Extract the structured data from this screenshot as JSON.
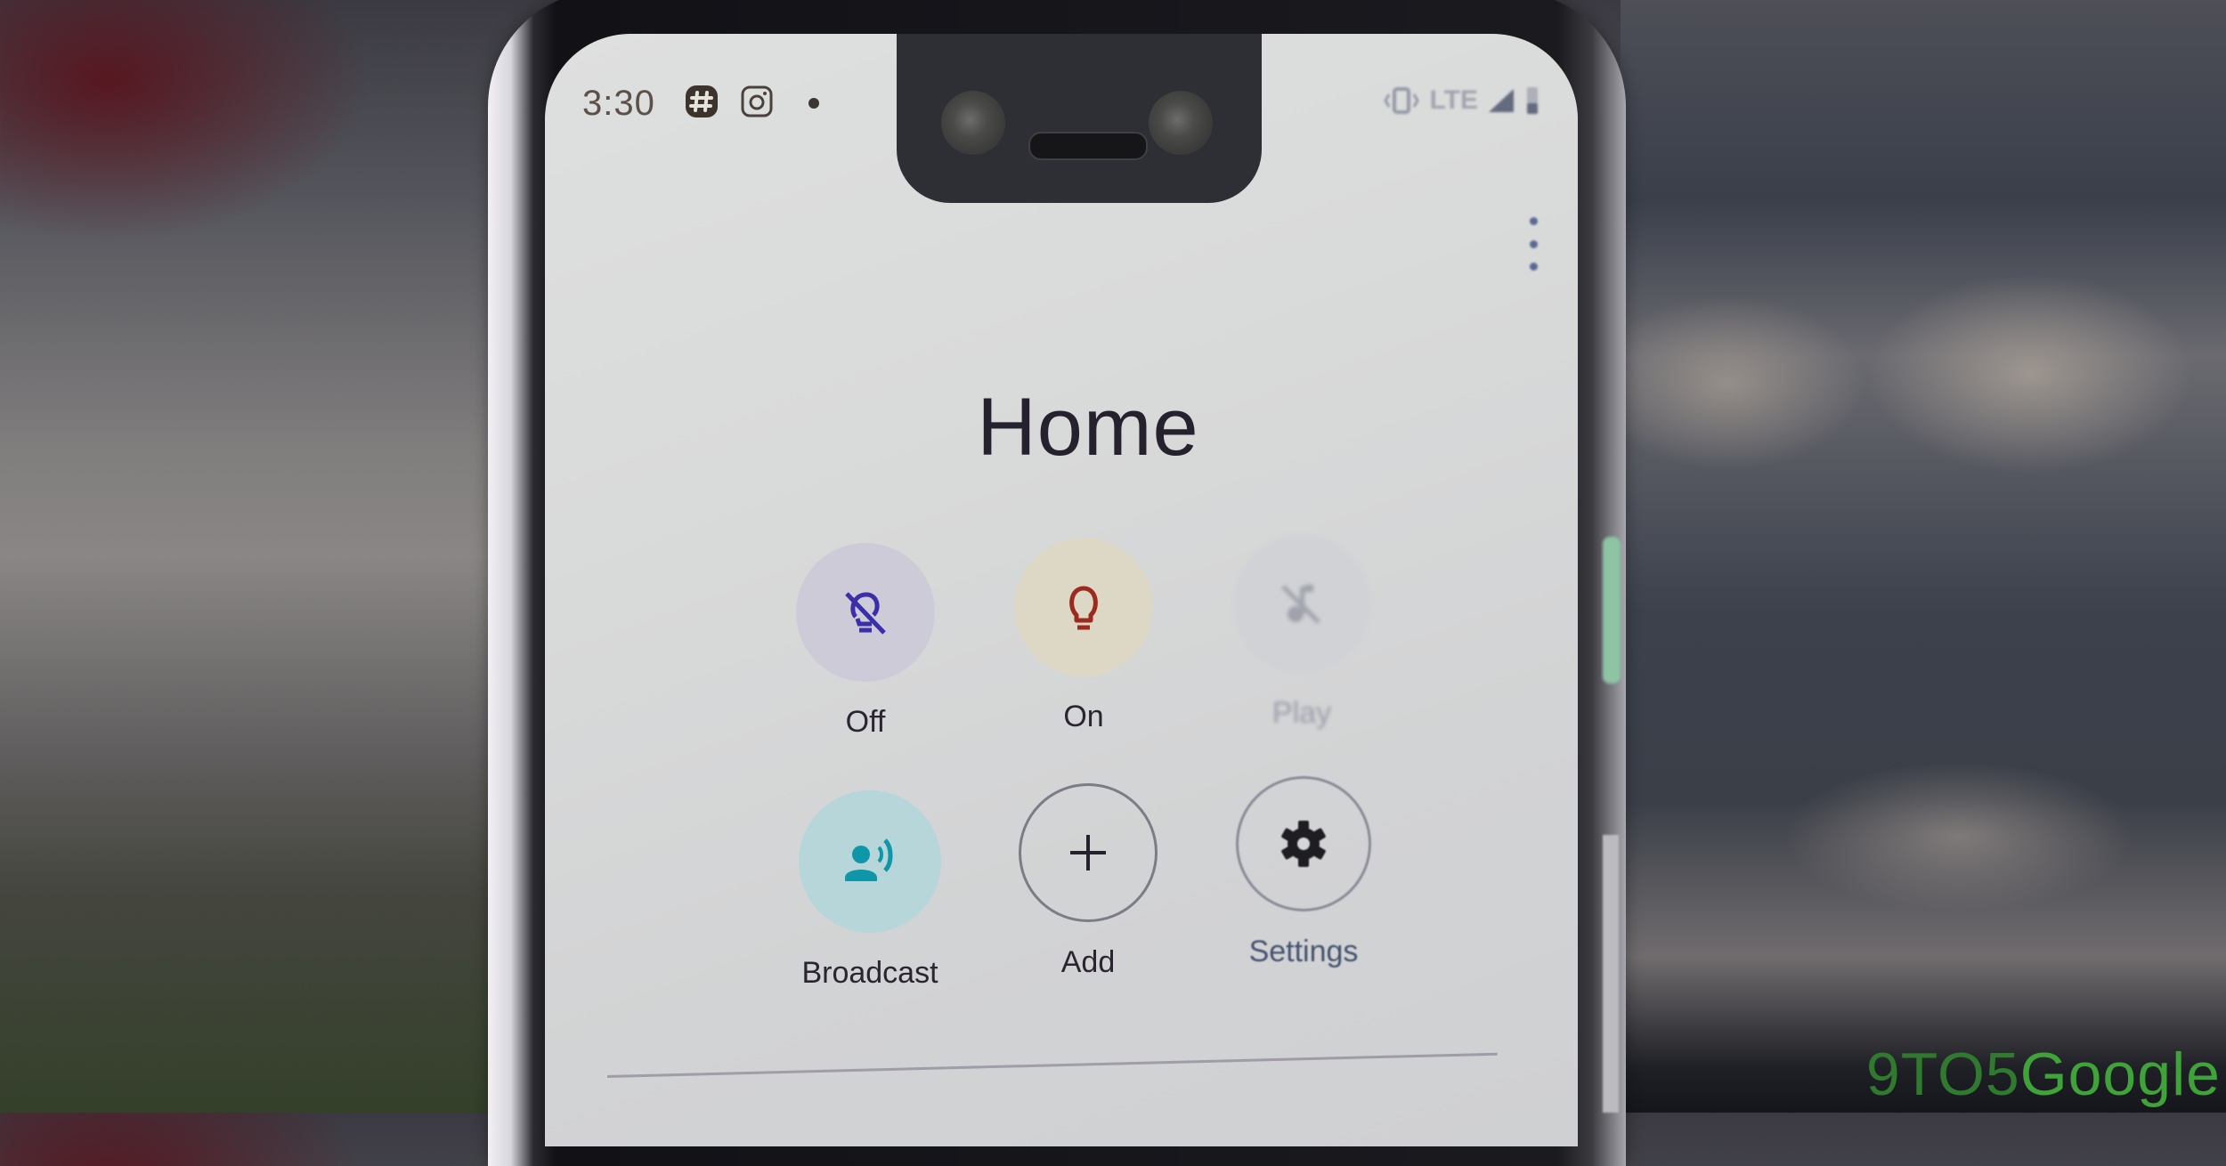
{
  "status_bar": {
    "time": "3:30",
    "left_icons": [
      "slack-icon",
      "instagram-icon",
      "notification-dot-icon"
    ],
    "network": "LTE",
    "right_icons": [
      "vibrate-icon",
      "signal-icon",
      "battery-icon"
    ]
  },
  "header": {
    "title": "Home",
    "overflow_menu": "more-vert-icon"
  },
  "actions": [
    {
      "label": "Off",
      "icon": "lightbulb-off-icon",
      "state": "enabled",
      "color": "#3a2fa8",
      "bg": "#cdcbd8"
    },
    {
      "label": "On",
      "icon": "lightbulb-icon",
      "state": "enabled",
      "color": "#9a2b1e",
      "bg": "#ddd7c6"
    },
    {
      "label": "Play",
      "icon": "music-off-icon",
      "state": "disabled",
      "color": "#8a8e9b",
      "bg": "#d0d1d5"
    },
    {
      "label": "Broadcast",
      "icon": "broadcast-icon",
      "state": "enabled",
      "color": "#0f96a8",
      "bg": "#b6d6d9"
    },
    {
      "label": "Add",
      "icon": "plus-icon",
      "state": "enabled",
      "color": "#25222e",
      "bg": "transparent"
    },
    {
      "label": "Settings",
      "icon": "gear-icon",
      "state": "enabled",
      "color": "#1e1e22",
      "bg": "transparent"
    }
  ],
  "watermark": {
    "prefix": "9TO5",
    "suffix": "Google",
    "color": "#3fa33a"
  }
}
